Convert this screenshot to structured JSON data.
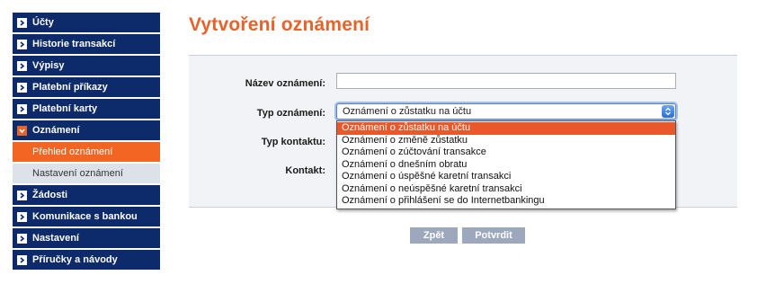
{
  "sidebar": {
    "items": [
      {
        "label": "Účty"
      },
      {
        "label": "Historie transakcí"
      },
      {
        "label": "Výpisy"
      },
      {
        "label": "Platební příkazy"
      },
      {
        "label": "Platební karty"
      },
      {
        "label": "Oznámení"
      },
      {
        "label": "Žádosti"
      },
      {
        "label": "Komunikace s bankou"
      },
      {
        "label": "Nastavení"
      },
      {
        "label": "Příručky a návody"
      }
    ],
    "subitems": [
      {
        "label": "Přehled oznámení"
      },
      {
        "label": "Nastavení oznámení"
      }
    ]
  },
  "page": {
    "title": "Vytvoření oznámení"
  },
  "form": {
    "name_label": "Název oznámení:",
    "name_value": "",
    "type_label": "Typ oznámení:",
    "type_selected": "Oznámení o zůstatku na účtu",
    "contact_type_label": "Typ kontaktu:",
    "contact_label": "Kontakt:",
    "options": [
      "Oznámení o zůstatku na účtu",
      "Oznámení o změně zůstatku",
      "Oznámení o zúčtování transakce",
      "Oznámení o dnešním obratu",
      "Oznámení o úspěšné karetní transakci",
      "Oznámení o neúspěšné karetní transakci",
      "Oznámení o přihlášení se do Internetbankingu"
    ]
  },
  "buttons": {
    "back": "Zpět",
    "confirm": "Potvrdit"
  },
  "colors": {
    "nav_bg": "#0d2a6b",
    "accent": "#e8622a",
    "button_bg": "#9ea8bd",
    "panel_bg": "#f1f3f7"
  }
}
